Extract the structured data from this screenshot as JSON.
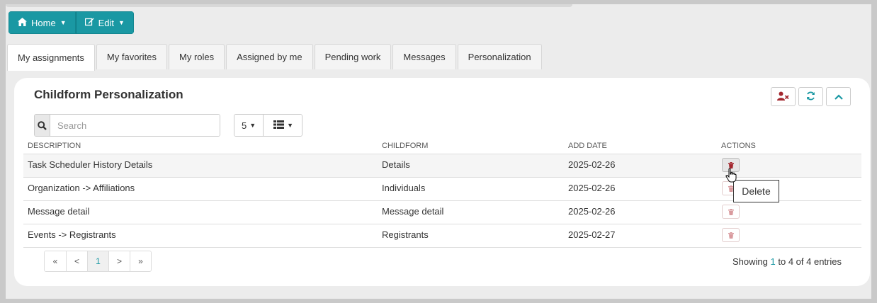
{
  "toolbar": {
    "home_label": "Home",
    "edit_label": "Edit"
  },
  "tabs": [
    {
      "label": "My assignments",
      "active": true
    },
    {
      "label": "My favorites"
    },
    {
      "label": "My roles"
    },
    {
      "label": "Assigned by me"
    },
    {
      "label": "Pending work"
    },
    {
      "label": "Messages"
    },
    {
      "label": "Personalization"
    }
  ],
  "panel": {
    "title": "Childform Personalization",
    "search_placeholder": "Search",
    "page_size": "5"
  },
  "table": {
    "headers": [
      "DESCRIPTION",
      "CHILDFORM",
      "ADD DATE",
      "ACTIONS"
    ],
    "rows": [
      {
        "description": "Task Scheduler History Details",
        "childform": "Details",
        "add_date": "2025-02-26"
      },
      {
        "description": "Organization -> Affiliations",
        "childform": "Individuals",
        "add_date": "2025-02-26"
      },
      {
        "description": "Message detail",
        "childform": "Message detail",
        "add_date": "2025-02-26"
      },
      {
        "description": "Events -> Registrants",
        "childform": "Registrants",
        "add_date": "2025-02-27"
      }
    ]
  },
  "tooltip": "Delete",
  "pagination": {
    "first": "«",
    "prev": "<",
    "current": "1",
    "next": ">",
    "last": "»"
  },
  "showing": {
    "prefix": "Showing ",
    "from": "1",
    "to_word": " to ",
    "to": "4",
    "of_word": " of ",
    "total": "4",
    "suffix": " entries"
  },
  "colors": {
    "accent": "#1a98a3",
    "danger": "#a3262e"
  }
}
